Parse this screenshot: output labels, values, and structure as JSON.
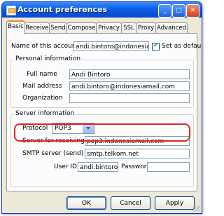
{
  "window": {
    "title": "Account preferences"
  },
  "titlebar_buttons": {
    "minimize": "_",
    "maximize": "□",
    "close": "✕"
  },
  "tabs": [
    "Basic",
    "Receive",
    "Send",
    "Compose",
    "Privacy",
    "SSL",
    "Proxy",
    "Advanced"
  ],
  "account": {
    "name_label": "Name of this account",
    "name_value": "andi.bintoro@indonesiamail.c",
    "default_label": "Set as default",
    "default_checked": true
  },
  "personal": {
    "legend": "Personal information",
    "fullname_label": "Full name",
    "fullname_value": "Andi Bintoro",
    "mail_label": "Mail address",
    "mail_value": "andi.bintoro@indonesiamail.com",
    "org_label": "Organization",
    "org_value": ""
  },
  "server": {
    "legend": "Server information",
    "protocol_label": "Protocol",
    "protocol_value": "POP3",
    "receive_label": "Server for receiving",
    "receive_value": "pop3.indonesiamail.com",
    "smtp_label": "SMTP server (send)",
    "smtp_value": "smtp.telkom.net",
    "userid_label": "User ID",
    "userid_value": "andi.bintoro",
    "password_label": "Password",
    "password_value": ""
  },
  "buttons": {
    "ok": "OK",
    "cancel": "Cancel",
    "apply": "Apply"
  },
  "colors": {
    "titlebar": "#0a5ee8",
    "highlight": "#e0281c",
    "tab_accent": "#e68b2c"
  }
}
